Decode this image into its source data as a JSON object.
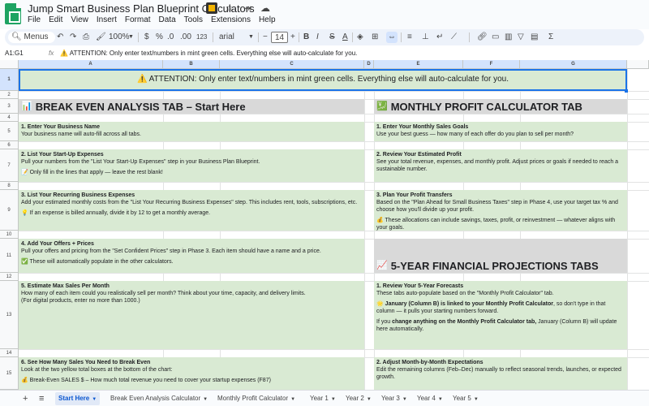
{
  "app": {
    "title": "Jump Smart Business Plan Blueprint Calculators",
    "menu": [
      "File",
      "Edit",
      "View",
      "Insert",
      "Format",
      "Data",
      "Tools",
      "Extensions",
      "Help"
    ],
    "title_icons": [
      "folder-icon",
      "star-icon",
      "move-icon",
      "cloud-icon"
    ]
  },
  "toolbar": {
    "search_label": "Menus",
    "zoom": "100%",
    "currency": "$",
    "percent": "%",
    "dec_decrease": ".0",
    "dec_increase": ".00",
    "number_format": "123",
    "font": "arial",
    "font_size": "14",
    "minus": "−",
    "plus": "+",
    "bold": "B",
    "italic": "I",
    "strike": "S",
    "text_color": "A",
    "sigma": "Σ"
  },
  "formula_bar": {
    "cell_ref": "A1:G1",
    "fx": "fx",
    "content": "⚠️ ATTENTION: Only enter text/numbers in mint green cells. Everything else will auto-calculate for you."
  },
  "columns": [
    "A",
    "B",
    "C",
    "D",
    "E",
    "F",
    "G"
  ],
  "rows": [
    "1",
    "2",
    "3",
    "4",
    "5",
    "6",
    "7",
    "8",
    "9",
    "10",
    "11",
    "12",
    "13",
    "14",
    "15"
  ],
  "cells": {
    "attention": "⚠️ ATTENTION: Only enter text/numbers in mint green cells. Everything else will auto-calculate for you.",
    "left_heading": {
      "icon": "📊",
      "text": "BREAK EVEN ANALYSIS TAB – Start Here"
    },
    "right_heading": {
      "icon": "💹",
      "text": "MONTHLY PROFIT CALCULATOR TAB"
    },
    "projections_heading": {
      "icon": "📈",
      "text": "5-YEAR FINANCIAL PROJECTIONS TABS"
    },
    "l1_title": "1. Enter Your Business Name",
    "l1_body": "Your business name will auto-fill across all tabs.",
    "l2_title": "2. List Your Start-Up Expenses",
    "l2_body": "Pull your numbers from the \"List Your Start-Up Expenses\" step in your Business Plan Blueprint.",
    "l2_note": "📝 Only fill in the lines that apply — leave the rest blank!",
    "l3_title": "3. List Your Recurring Business Expenses",
    "l3_body": "Add your estimated monthly costs from the \"List Your Recurring Business Expenses\" step. This includes rent, tools, subscriptions, etc.",
    "l3_note": "💡 If an expense is billed annually, divide it by 12 to get a monthly average.",
    "l4_title": "4. Add Your Offers + Prices",
    "l4_body": "Pull your offers and pricing from the \"Set Confident Prices\" step in Phase 3. Each item should have a name and a price.",
    "l4_note": "✅ These will automatically populate in the other calculators.",
    "l5_title": "5. Estimate Max Sales Per Month",
    "l5_body": "How many of each item could you realistically sell per month? Think about your time, capacity, and delivery limits.",
    "l5_note": "(For digital products, enter no more than 1000.)",
    "l6_title": "6. See How Many Sales You Need to Break Even",
    "l6_body": "Look at the two yellow total boxes at the bottom of the chart:",
    "l6_note": "💰 Break-Even SALES $ – How much total revenue you need to cover your startup expenses (F87)",
    "r1_title": "1. Enter Your Monthly Sales Goals",
    "r1_body": "Use your best guess — how many of each offer do you plan to sell per month?",
    "r2_title": "2. Review Your Estimated Profit",
    "r2_body": "See your total revenue, expenses, and monthly profit. Adjust prices or goals if needed to reach a sustainable number.",
    "r3_title": "3. Plan Your Profit Transfers",
    "r3_body": "Based on the \"Plan Ahead for Small Business Taxes\" step in Phase 4, use your target tax % and choose how you'll divide up your profit.",
    "r3_note": "💰 These allocations can include savings, taxes, profit, or reinvestment — whatever aligns with your goals.",
    "p1_title": "1. Review Your 5-Year Forecasts",
    "p1_body": "These tabs auto-populate based on the \"Monthly Profit Calculator\" tab.",
    "p1_note_pre": "🌟 ",
    "p1_note_bold": "January (Column B) is linked to your Monthly Profit Calculator",
    "p1_note_post": ", so don't type in that column — it pulls your starting numbers forward.",
    "p1_if_pre": "If you ",
    "p1_if_bold": "change anything on the Monthly Profit Calculator tab,",
    "p1_if_post": " January (Column B) will update here automatically.",
    "p2_title": "2. Adjust Month-by-Month Expectations",
    "p2_body": "Edit the remaining columns (Feb–Dec) manually to reflect seasonal trends, launches, or expected growth."
  },
  "sheet_tabs": {
    "add": "+",
    "list": "≡",
    "tabs": [
      "Start Here",
      "Break Even Analysis Calculator",
      "Monthly Profit Calculator",
      "Year 1",
      "Year 2",
      "Year 3",
      "Year 4",
      "Year 5"
    ],
    "active": "Start Here"
  },
  "colors": {
    "mint_green": "#d9ead3",
    "gray_heading": "#d9d9d9",
    "selection_blue": "#1a73e8"
  }
}
